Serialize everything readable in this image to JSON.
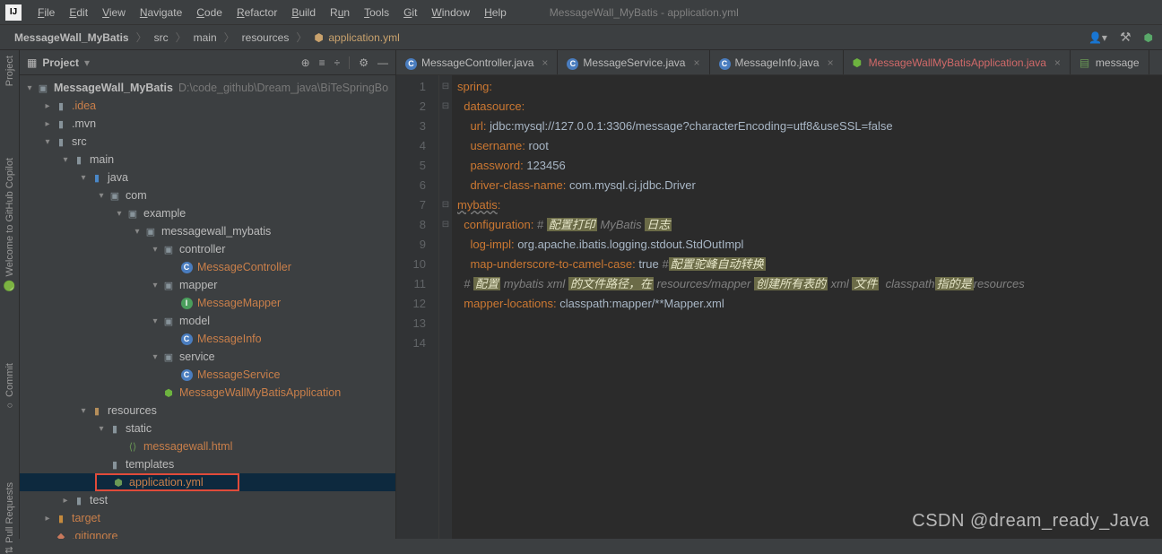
{
  "menu": {
    "items": [
      "File",
      "Edit",
      "View",
      "Navigate",
      "Code",
      "Refactor",
      "Build",
      "Run",
      "Tools",
      "Git",
      "Window",
      "Help"
    ],
    "titlePath": "MessageWall_MyBatis - application.yml"
  },
  "breadcrumb": {
    "root": "MessageWall_MyBatis",
    "parts": [
      "src",
      "main",
      "resources"
    ],
    "file": "application.yml"
  },
  "projectPanel": {
    "title": "Project"
  },
  "tree": {
    "root": "MessageWall_MyBatis",
    "rootPath": "D:\\code_github\\Dream_java\\BiTeSpringBo",
    "idea": ".idea",
    "mvn": ".mvn",
    "src": "src",
    "main": "main",
    "java": "java",
    "com": "com",
    "example": "example",
    "pkg": "messagewall_mybatis",
    "controller": "controller",
    "MessageController": "MessageController",
    "mapper": "mapper",
    "MessageMapper": "MessageMapper",
    "model": "model",
    "MessageInfo": "MessageInfo",
    "service": "service",
    "MessageService": "MessageService",
    "appClass": "MessageWallMyBatisApplication",
    "resources": "resources",
    "static": "static",
    "messagewallHtml": "messagewall.html",
    "templates": "templates",
    "applicationYml": "application.yml",
    "test": "test",
    "target": "target",
    "gitignore": ".gitignore"
  },
  "tabs": [
    {
      "label": "MessageController.java",
      "color": "norm"
    },
    {
      "label": "MessageService.java",
      "color": "norm"
    },
    {
      "label": "MessageInfo.java",
      "color": "norm"
    },
    {
      "label": "MessageWallMyBatisApplication.java",
      "color": "red"
    },
    {
      "label": "message",
      "color": "norm"
    }
  ],
  "code": {
    "l1": {
      "k": "spring",
      "c": ":"
    },
    "l2": {
      "k": "datasource",
      "c": ":"
    },
    "l3": {
      "k": "url",
      "c": ": ",
      "v": "jdbc:mysql://127.0.0.1:3306/message?characterEncoding=utf8&useSSL=false"
    },
    "l4": {
      "k": "username",
      "c": ": ",
      "v": "root"
    },
    "l5": {
      "k": "password",
      "c": ": ",
      "v": "123456"
    },
    "l6": {
      "k": "driver-class-name",
      "c": ": ",
      "v": "com.mysql.cj.jdbc.Driver"
    },
    "l7": {
      "k": "mybatis",
      "c": ":"
    },
    "l8": {
      "k": "configuration",
      "c": ": ",
      "cm": "# ",
      "h1": "配置打印",
      "cm2": " MyBatis ",
      "h2": "日志"
    },
    "l9": {
      "k": "log-impl",
      "c": ": ",
      "v": "org.apache.ibatis.logging.stdout.StdOutImpl"
    },
    "l10": {
      "k": "map-underscore-to-camel-case",
      "c": ": ",
      "v": "true ",
      "cm": "#",
      "h": "配置驼峰自动转换"
    },
    "l11": {
      "cm": "# ",
      "h1": "配置",
      "t1": " mybatis xml ",
      "h2": "的文件路径，在",
      "t2": " resources/mapper ",
      "h3": "创建所有表的",
      "t3": " xml ",
      "h4": "文件",
      "sp": "  classpath",
      "h5": "指的是",
      "t4": "resources"
    },
    "l12": {
      "k": "mapper-locations",
      "c": ": ",
      "v": "classpath:mapper/**Mapper.xml"
    }
  },
  "watermark": "CSDN @dream_ready_Java"
}
